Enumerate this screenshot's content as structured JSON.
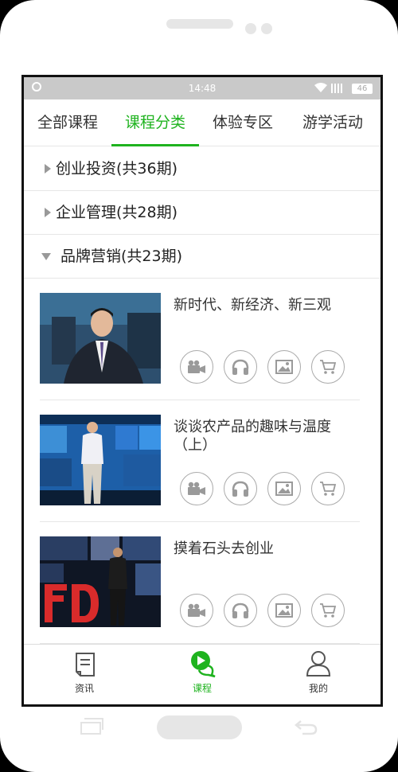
{
  "status_bar": {
    "time": "14:48",
    "battery": "46"
  },
  "tabs": [
    {
      "label": "全部课程"
    },
    {
      "label": "课程分类"
    },
    {
      "label": "体验专区"
    },
    {
      "label": "游学活动"
    }
  ],
  "active_tab": "课程分类",
  "categories": [
    {
      "label": "创业投资(共36期)",
      "expanded": false
    },
    {
      "label": "企业管理(共28期)",
      "expanded": false
    },
    {
      "label": "品牌营销(共23期)",
      "expanded": true
    }
  ],
  "courses": [
    {
      "title": "新时代、新经济、新三观",
      "thumb": "speaker-in-suit-armchair"
    },
    {
      "title": "谈谈农产品的趣味与温度（上）",
      "thumb": "speaker-on-stage-blue-screens"
    },
    {
      "title": "摸着石头去创业",
      "thumb": "speaker-on-stage-red-letters"
    }
  ],
  "course_actions": [
    {
      "icon": "video-camera-icon"
    },
    {
      "icon": "headphones-icon"
    },
    {
      "icon": "image-icon"
    },
    {
      "icon": "cart-icon"
    }
  ],
  "bottom_nav": [
    {
      "label": "资讯",
      "icon": "news-icon"
    },
    {
      "label": "课程",
      "icon": "chat-play-icon"
    },
    {
      "label": "我的",
      "icon": "user-icon"
    }
  ],
  "colors": {
    "accent": "#1fb31f",
    "status_bar": "#c9c9c9",
    "divider": "#e6e6e6",
    "icon_gray": "#9a9a9a"
  }
}
